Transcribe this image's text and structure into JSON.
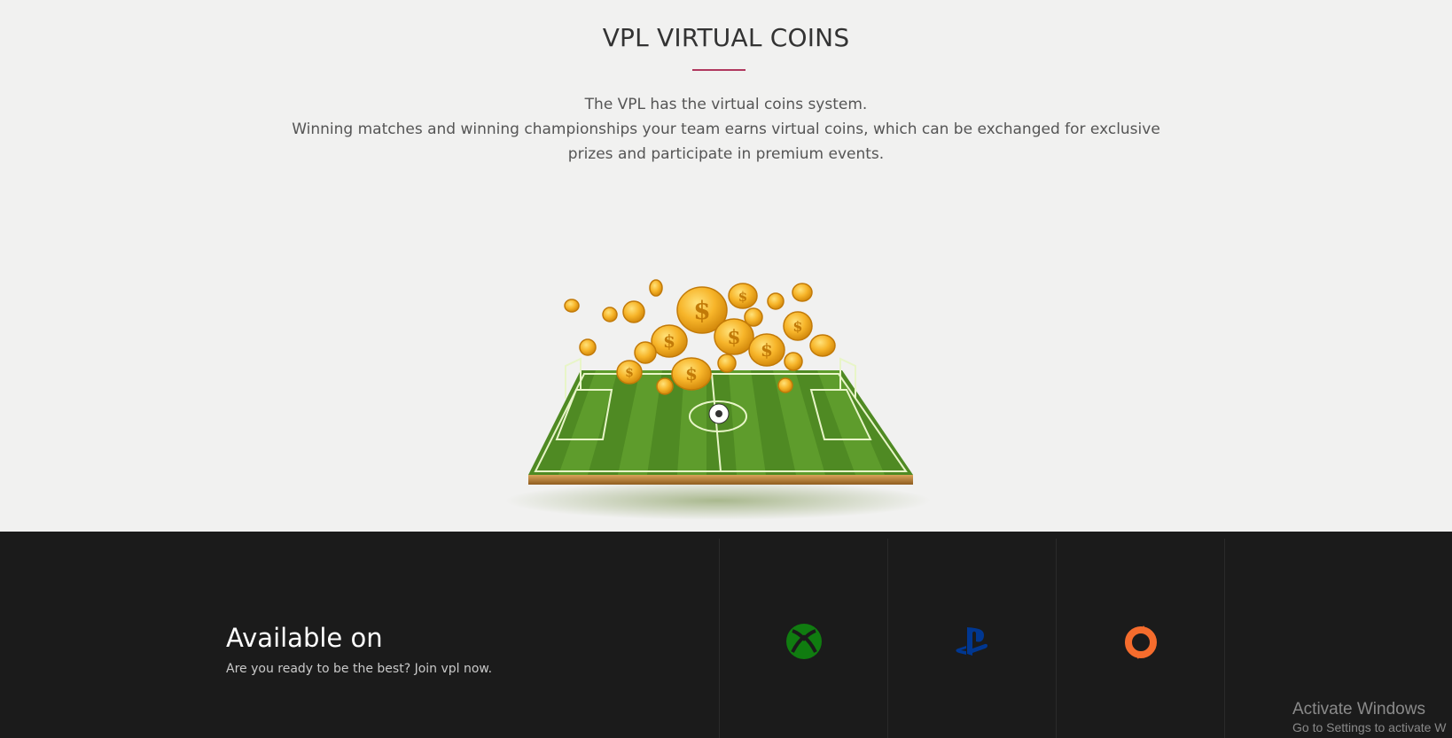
{
  "coins": {
    "title": "VPL VIRTUAL COINS",
    "accent_color": "#b0385e",
    "description_line1": "The VPL has the virtual coins system.",
    "description_line2": "Winning matches and winning championships your team earns virtual coins, which can be exchanged for exclusive prizes and participate in premium events.",
    "illustration": "soccer-field-with-gold-coins"
  },
  "available": {
    "title": "Available on",
    "subtitle": "Are you ready to be the best? Join vpl now.",
    "platforms": [
      {
        "icon": "xbox-icon",
        "color": "#107c10"
      },
      {
        "icon": "playstation-icon",
        "color": "#003791"
      },
      {
        "icon": "origin-icon",
        "color": "#f56c2d"
      }
    ]
  },
  "watermark": {
    "title": "Activate Windows",
    "subtitle": "Go to Settings to activate W"
  }
}
